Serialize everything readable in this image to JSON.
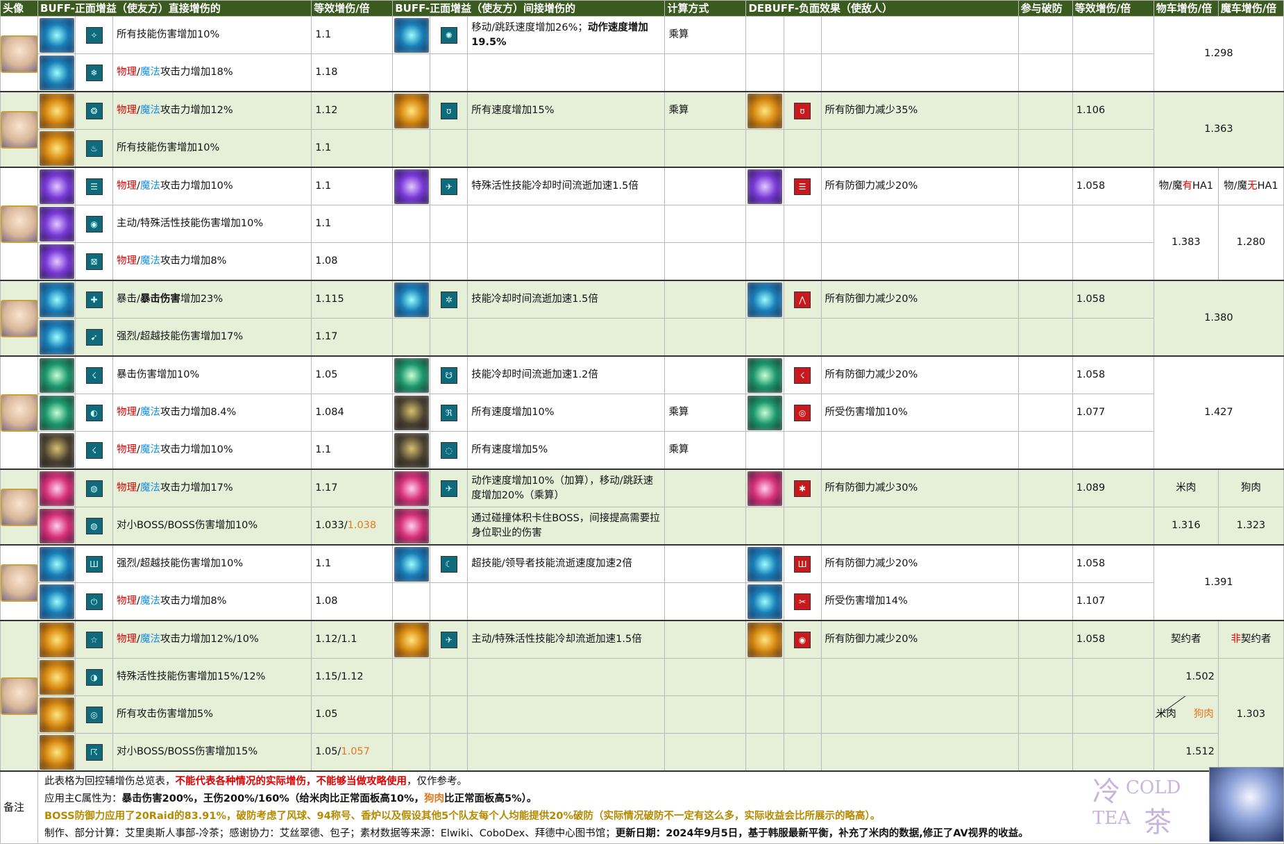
{
  "header": {
    "avatar": "头像",
    "buff_direct": "BUFF-正面增益（使友方）直接增伤的",
    "equiv1": "等效增伤/倍",
    "buff_indirect": "BUFF-正面增益（使友方）间接增伤的",
    "calc": "计算方式",
    "debuff": "DEBUFF-负面效果（使敌人）",
    "def_break": "参与破防",
    "equiv2": "等效增伤/倍",
    "phys_total": "物车增伤/倍",
    "mag_total": "魔车增伤/倍"
  },
  "frag": {
    "phys": "物理",
    "mag": "魔法",
    "slash": "/",
    "atk_up": "攻击力增加",
    "mult": "乘算",
    "crit_a": "暴击/",
    "crit_b": "暴击伤害",
    "crit_c": "增加23%"
  },
  "rows": {
    "r1": {
      "buff": "所有技能伤害增加10%",
      "val": "1.1",
      "ib": "移动/跳跃速度增加26%；",
      "ib_bold": "动作速度增加19.5%",
      "total": "1.298"
    },
    "r2": {
      "buff_pct": "18%",
      "val": "1.18"
    },
    "r3": {
      "buff_pct": "12%",
      "val": "1.12",
      "ib": "所有速度增加15%",
      "db": "所有防御力减少35%",
      "dv": "1.106",
      "total": "1.363"
    },
    "r4": {
      "buff": "所有技能伤害增加10%",
      "val": "1.1"
    },
    "r5": {
      "buff_pct": "10%",
      "val": "1.1",
      "ib": "特殊活性技能冷却时间流逝加速1.5倍",
      "db": "所有防御力减少20%",
      "dv": "1.058",
      "ph_a": "物/魔",
      "ph_b": "有",
      "ph_c": "HA1",
      "mg_a": "物/魔",
      "mg_b": "无",
      "mg_c": "HA1"
    },
    "r6": {
      "buff": "主动/特殊活性技能伤害增加10%",
      "val": "1.1",
      "p": "1.383",
      "m": "1.280"
    },
    "r7": {
      "buff_pct": "8%",
      "val": "1.08"
    },
    "r8": {
      "val": "1.115",
      "ib": "技能冷却时间流逝加速1.5倍",
      "db": "所有防御力减少20%",
      "dv": "1.058",
      "total": "1.380"
    },
    "r9": {
      "buff": "强烈/超越技能伤害增加17%",
      "val": "1.17"
    },
    "r10": {
      "buff": "暴击伤害增加10%",
      "val": "1.05",
      "ib": "技能冷却时间流逝加速1.2倍",
      "db": "所有防御力减少20%",
      "dv": "1.058"
    },
    "r11": {
      "buff_pct": "8.4%",
      "val": "1.084",
      "ib": "所有速度增加10%",
      "db": "所受伤害增加10%",
      "dv": "1.077",
      "total": "1.427"
    },
    "r12": {
      "buff_pct": "10%",
      "val": "1.1",
      "ib": "所有速度增加5%"
    },
    "r13": {
      "buff_pct": "17%",
      "val": "1.17",
      "ib": "动作速度增加10%（加算），移动/跳跃速度增加20%（乘算）",
      "db": "所有防御力减少30%",
      "dv": "1.089",
      "p": "米肉",
      "m": "狗肉"
    },
    "r14": {
      "buff": "对小BOSS/BOSS伤害增加10%",
      "val_a": "1.033/",
      "val_b": "1.038",
      "ib": "通过碰撞体积卡住BOSS，间接提高需要拉身位职业的伤害",
      "p": "1.316",
      "m": "1.323"
    },
    "r15": {
      "buff": "强烈/超越技能伤害增加10%",
      "val": "1.1",
      "ib": "超技能/领导者技能流逝速度加速2倍",
      "db": "所有防御力减少20%",
      "dv": "1.058",
      "total": "1.391"
    },
    "r16": {
      "buff_pct": "8%",
      "val": "1.08",
      "db": "所受伤害增加14%",
      "dv": "1.107"
    },
    "r17": {
      "buff_pct": "12%/10%",
      "val": "1.12/1.1",
      "ib": "主动/特殊活性技能冷却流逝加速1.5倍",
      "db": "所有防御力减少20%",
      "dv": "1.058",
      "p": "契约者",
      "m_a": "非",
      "m_b": "契约者"
    },
    "r18": {
      "buff": "特殊活性技能伤害增加15%/12%",
      "val": "1.15/1.12",
      "p": "1.502",
      "m": "1.303"
    },
    "r19": {
      "buff": "所有攻击伤害增加5%",
      "val": "1.05",
      "p_a": "米肉",
      "p_b": "狗肉"
    },
    "r20": {
      "buff": "对小BOSS/BOSS伤害增加15%",
      "val_a": "1.05/",
      "val_b": "1.057",
      "p": "1.512"
    }
  },
  "notes": {
    "label": "备注",
    "l1_a": "此表格为回控辅增伤总览表，",
    "l1_b": "不能代表各种情况的实际增伤，不能够当做攻略使用",
    "l1_c": "，仅作参考。",
    "l2_a": "应用主C属性为：",
    "l2_b": "暴击伤害200%，王伤200%/160%（给米肉比正常面板高10%，",
    "l2_c": "狗肉",
    "l2_d": "比正常面板高5%）。",
    "l3": "BOSS防御力应用了20Raid的83.91%，破防考虑了风球、94称号、香炉以及假设其他5个队友每个人均能提供20%破防（实际情况破防不一定有这么多，实际收益会比所展示的略高）。",
    "l4_a": "制作、部分计算：艾里奥斯人事部-冷茶；感谢协力：艾丝翠德、包子；素材数据等来源：Elwiki、CoboDex、拜德中心图书馆；",
    "l4_b": "更新日期：2024年9月5日，基于韩服最新平衡，补充了米肉的数据,修正了AV视界的收益。"
  },
  "logo": {
    "cn1": "冷",
    "en1": "COLD",
    "en2": "TEA",
    "cn2": "茶"
  }
}
